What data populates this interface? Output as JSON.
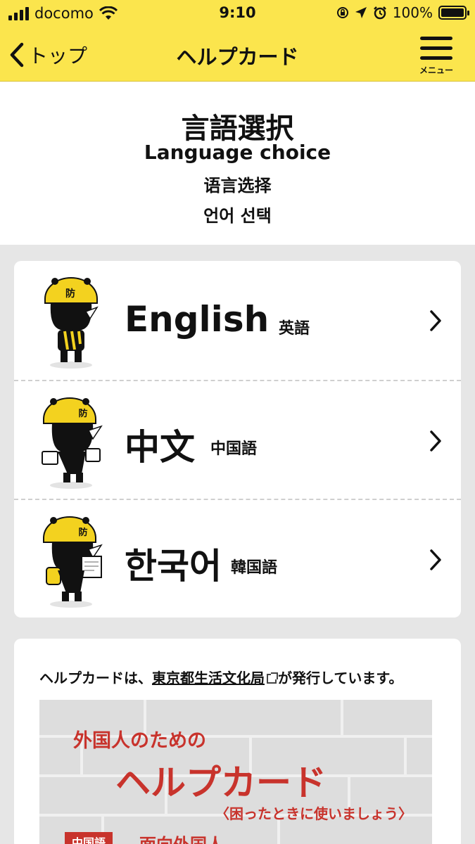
{
  "status_bar": {
    "carrier": "docomo",
    "time": "9:10",
    "battery": "100%",
    "battery_level": 1.0
  },
  "navbar": {
    "back_label": "トップ",
    "title": "ヘルプカード",
    "menu_label": "メニュー"
  },
  "header": {
    "title_ja": "言語選択",
    "title_en": "Language choice",
    "title_zh": "语言选择",
    "title_ko": "언어 선택"
  },
  "languages": [
    {
      "name": "English",
      "name_ja": "英語",
      "icon": "rhino-mascot-icon"
    },
    {
      "name": "中文",
      "name_ja": "中国語",
      "icon": "rhino-mascot-icon"
    },
    {
      "name": "한국어",
      "name_ja": "韓国語",
      "icon": "rhino-mascot-icon"
    }
  ],
  "info": {
    "text_before": "ヘルプカードは、",
    "link": "東京都生活文化局",
    "text_after": "が発行しています。"
  },
  "banner": {
    "subtitle": "外国人のための",
    "title": "ヘルプカード",
    "note": "〈困ったときに使いましょう〉",
    "tag": "中国語",
    "to": "面向外国人"
  },
  "colors": {
    "accent": "#fbe54d",
    "banner_red": "#c8332c"
  }
}
